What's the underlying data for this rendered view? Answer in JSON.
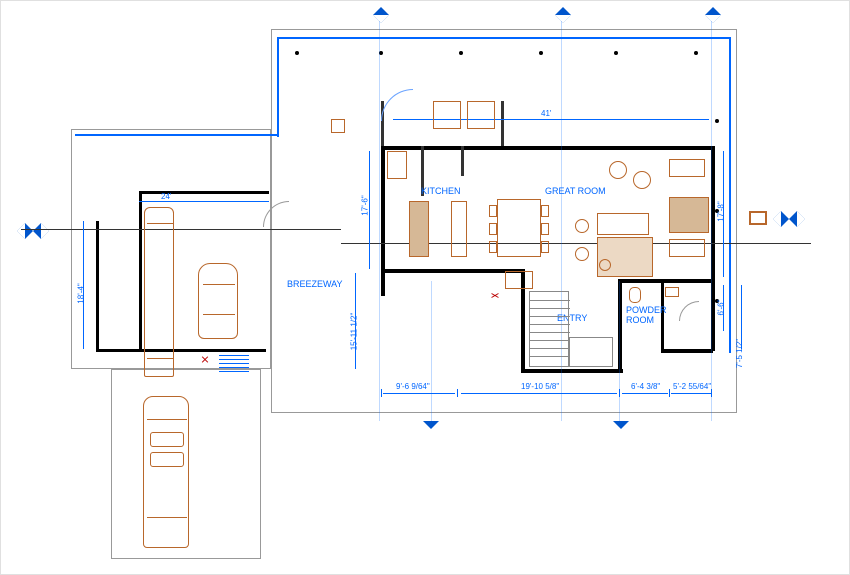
{
  "rooms": {
    "kitchen": "KITCHEN",
    "great_room": "GREAT ROOM",
    "entry": "ENTRY",
    "powder_room": "POWDER\nROOM",
    "breezeway": "BREEZEWAY"
  },
  "dimensions": {
    "w41": "41'",
    "h17_6": "17'-6\"",
    "h17_8": "17'-8\"",
    "h6_6": "6'-6\"",
    "h7_5_half": "7'-5 1/2\"",
    "h15_11_half": "15'-11 1/2\"",
    "h18_4": "18'-4\"",
    "w24": "24'",
    "w9_6": "9'-6 9/64\"",
    "w19_10": "19'-10 5/8\"",
    "w6_4": "6'-4 3/8\"",
    "w5_2": "5'-2 55/64\""
  },
  "colors": {
    "dimension": "#0066ff",
    "furniture": "#b8672b",
    "wall": "#000000",
    "marker_fill": "#0055cc"
  }
}
